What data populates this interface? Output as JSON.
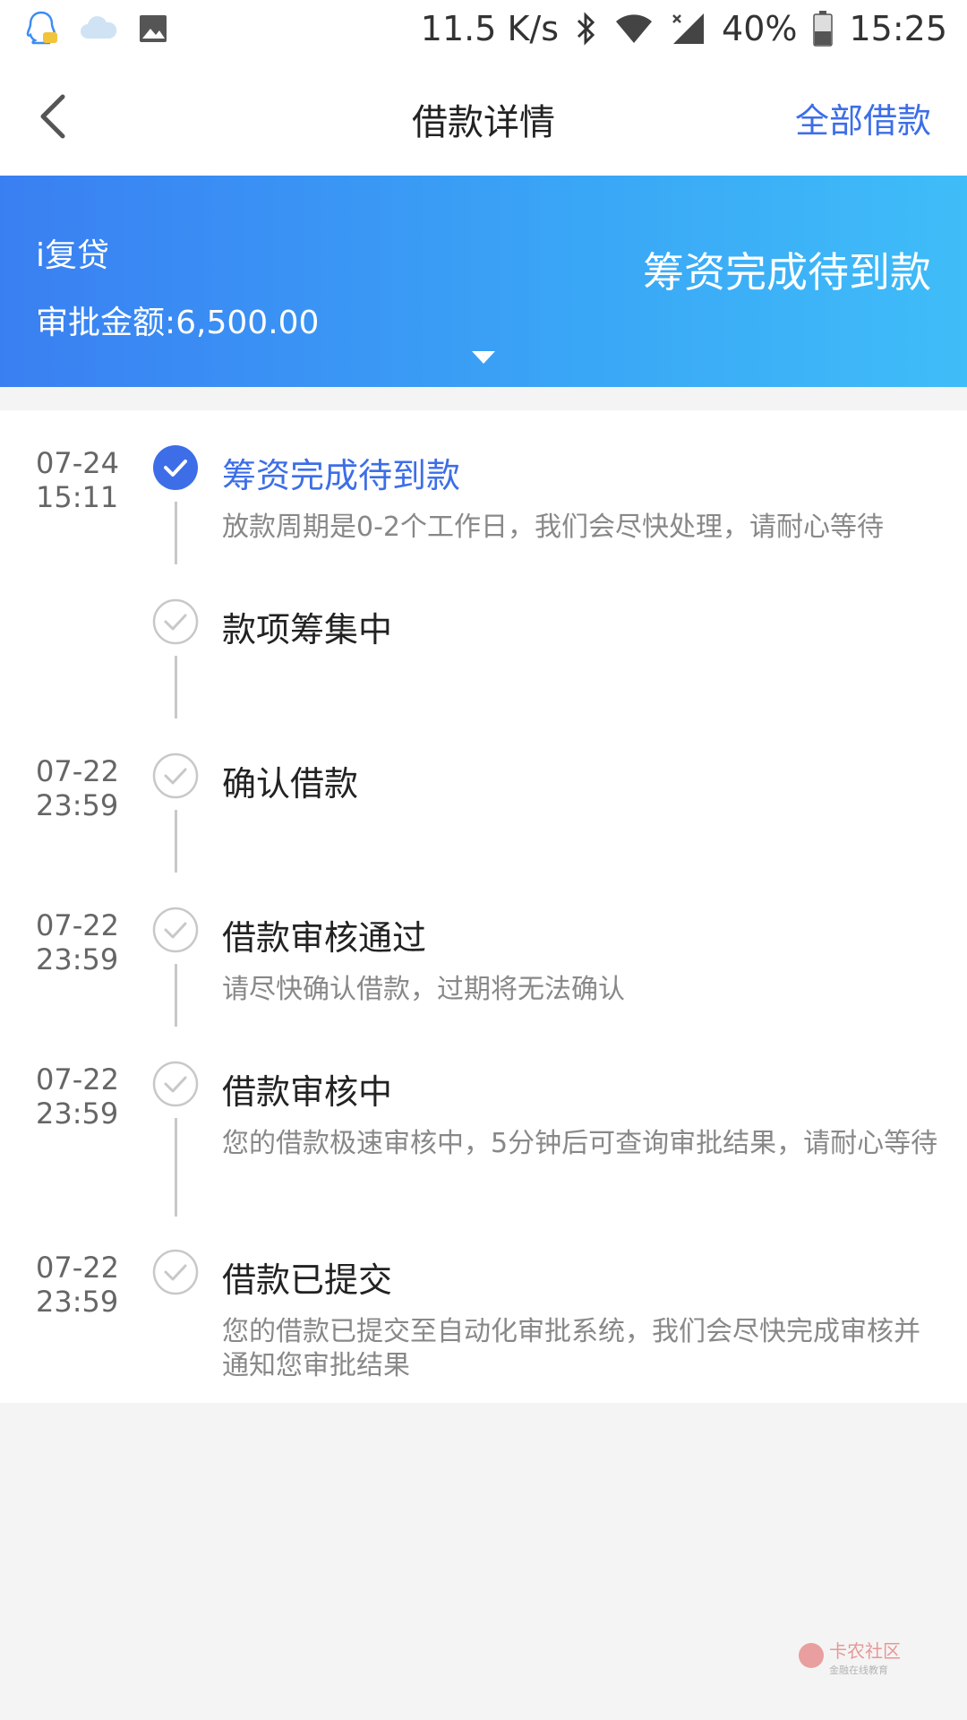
{
  "status_bar": {
    "speed": "11.5 K/s",
    "battery": "40%",
    "time": "15:25",
    "left_icons": [
      "qq-icon",
      "cloud-icon",
      "image-icon"
    ],
    "right_icons": [
      "bluetooth-icon",
      "wifi-icon",
      "signal-icon",
      "battery-icon"
    ]
  },
  "nav": {
    "title": "借款详情",
    "right_link": "全部借款"
  },
  "banner": {
    "product": "i复贷",
    "amount": "审批金额:6,500.00",
    "status": "筹资完成待到款"
  },
  "timeline": [
    {
      "date": "07-24",
      "time": "15:11",
      "title": "筹资完成待到款",
      "desc": "放款周期是0-2个工作日，我们会尽快处理，请耐心等待",
      "active": true
    },
    {
      "date": "",
      "time": "",
      "title": "款项筹集中",
      "desc": "",
      "active": false
    },
    {
      "date": "07-22",
      "time": "23:59",
      "title": "确认借款",
      "desc": "",
      "active": false
    },
    {
      "date": "07-22",
      "time": "23:59",
      "title": "借款审核通过",
      "desc": "请尽快确认借款，过期将无法确认",
      "active": false
    },
    {
      "date": "07-22",
      "time": "23:59",
      "title": "借款审核中",
      "desc": "您的借款极速审核中，5分钟后可查询审批结果，请耐心等待",
      "active": false
    },
    {
      "date": "07-22",
      "time": "23:59",
      "title": "借款已提交",
      "desc": "您的借款已提交至自动化审批系统，我们会尽快完成审核并通知您审批结果",
      "active": false
    }
  ],
  "watermark": {
    "brand": "卡农社区",
    "slogan": "金融在线教育"
  },
  "colors": {
    "accent": "#3d6ee8",
    "banner_start": "#3a7ff2",
    "banner_end": "#3fbdf8",
    "muted": "#888888"
  }
}
